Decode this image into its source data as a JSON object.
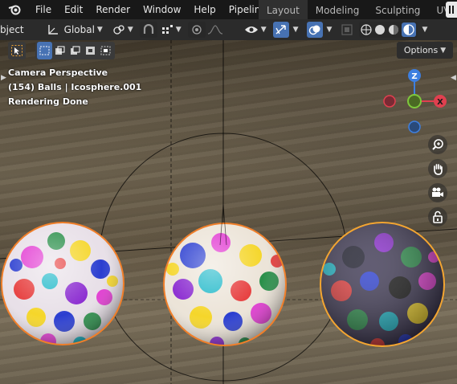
{
  "menubar": {
    "items": [
      "File",
      "Edit",
      "Render",
      "Window",
      "Help",
      "Pipeline"
    ],
    "workspaces": [
      "Layout",
      "Modeling",
      "Sculpting",
      "UV Editi"
    ]
  },
  "toolbar": {
    "object_label": "bject",
    "transform_orientation": "Global"
  },
  "viewport": {
    "view_name": "Camera Perspective",
    "object_info": "(154) Balls | Icosphere.001",
    "status": "Rendering Done",
    "options_label": "Options",
    "gizmo": {
      "z": "Z",
      "x": "X"
    }
  },
  "colors": {
    "accent": "#4772b3",
    "axis_x": "#e0404f",
    "axis_y": "#7ec83c",
    "axis_z": "#3d7fe0",
    "selection_outline": "#f07f2a",
    "active_outline": "#f3a531"
  },
  "icons": [
    "blender-logo",
    "pivot-icon",
    "snap-icon",
    "proportional-icon",
    "visibility-icon",
    "gizmo-icon",
    "overlay-icon",
    "xray-icon",
    "shading-wireframe-icon",
    "shading-solid-icon",
    "shading-material-icon",
    "shading-rendered-icon",
    "zoom-icon",
    "hand-icon",
    "camera-icon",
    "lock-icon"
  ]
}
